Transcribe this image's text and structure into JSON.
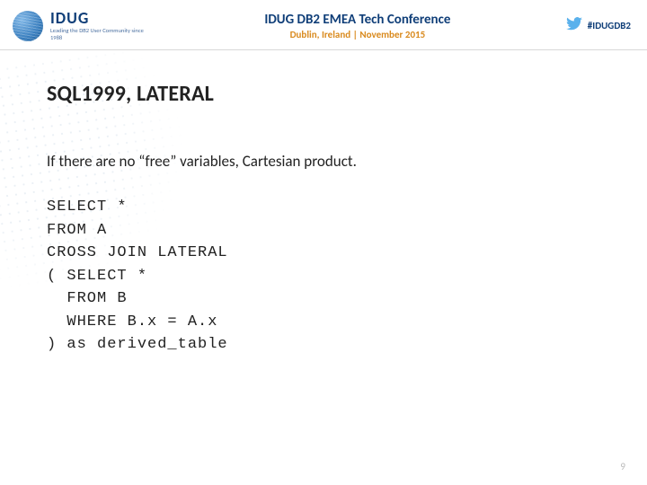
{
  "header": {
    "logo_acronym": "IDUG",
    "logo_tagline": "Leading the DB2 User Community since 1988",
    "conference_title": "IDUG DB2 EMEA Tech Conference",
    "conference_subtitle": "Dublin, Ireland | November 2015",
    "hashtag": "#IDUGDB2"
  },
  "slide": {
    "title": "SQL1999, LATERAL",
    "body": "If there are no “free” variables, Cartesian product.",
    "code": "SELECT *\nFROM A\nCROSS JOIN LATERAL\n( SELECT *\n  FROM B\n  WHERE B.x = A.x\n) as derived_table",
    "page_number": "9"
  }
}
